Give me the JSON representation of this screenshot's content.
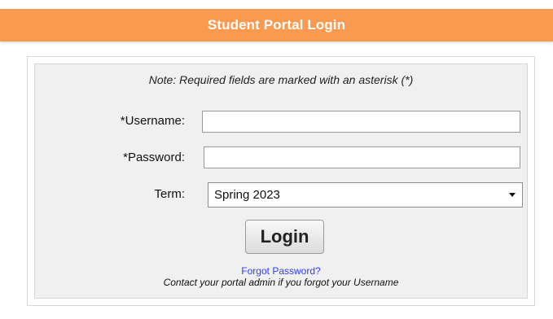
{
  "header": {
    "title": "Student Portal Login"
  },
  "form": {
    "note": "Note: Required fields are marked with an asterisk (*)",
    "username_label": "*Username:",
    "username_value": "",
    "password_label": "*Password:",
    "password_value": "",
    "term_label": "Term:",
    "term_value": "Spring 2023",
    "login_button": "Login"
  },
  "links": {
    "forgot_password": "Forgot Password?",
    "contact_text": "Contact your portal admin if you forgot your Username"
  },
  "colors": {
    "header_bg": "#fa9a50",
    "link": "#2f3dff"
  },
  "icons": {
    "dropdown_caret": "chevron-down-icon"
  }
}
